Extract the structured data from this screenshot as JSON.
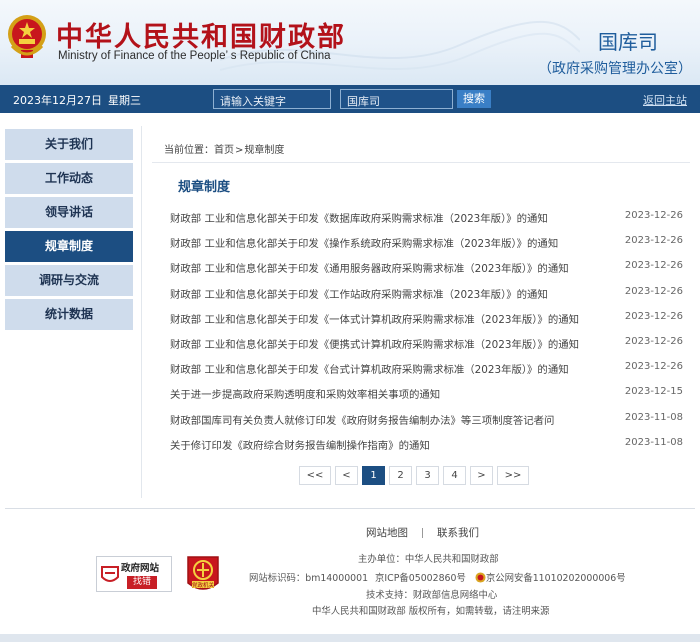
{
  "header": {
    "site_title_cn": "中华人民共和国财政部",
    "site_title_en": "Ministry of Finance of the People’ s Republic of China",
    "department": "国库司",
    "department_sub": "（政府采购管理办公室）"
  },
  "topbar": {
    "date": "2023年12月27日",
    "weekday": "星期三",
    "search_placeholder": "请输入关键字",
    "dept_select_value": "国库司",
    "search_button": "搜索",
    "home_link": "返回主站"
  },
  "sidebar": {
    "items": [
      {
        "label": "关于我们",
        "active": false
      },
      {
        "label": "工作动态",
        "active": false
      },
      {
        "label": "领导讲话",
        "active": false
      },
      {
        "label": "规章制度",
        "active": true
      },
      {
        "label": "调研与交流",
        "active": false
      },
      {
        "label": "统计数据",
        "active": false
      }
    ]
  },
  "breadcrumb": {
    "prefix": "当前位置：",
    "home": "首页",
    "separator": ">",
    "current": "规章制度"
  },
  "section_title": "规章制度",
  "news": [
    {
      "title": "财政部 工业和信息化部关于印发《数据库政府采购需求标准（2023年版）》的通知",
      "date": "2023-12-26"
    },
    {
      "title": "财政部 工业和信息化部关于印发《操作系统政府采购需求标准（2023年版）》的通知",
      "date": "2023-12-26"
    },
    {
      "title": "财政部 工业和信息化部关于印发《通用服务器政府采购需求标准（2023年版）》的通知",
      "date": "2023-12-26"
    },
    {
      "title": "财政部 工业和信息化部关于印发《工作站政府采购需求标准（2023年版）》的通知",
      "date": "2023-12-26"
    },
    {
      "title": "财政部 工业和信息化部关于印发《一体式计算机政府采购需求标准（2023年版）》的通知",
      "date": "2023-12-26"
    },
    {
      "title": "财政部 工业和信息化部关于印发《便携式计算机政府采购需求标准（2023年版）》的通知",
      "date": "2023-12-26"
    },
    {
      "title": "财政部 工业和信息化部关于印发《台式计算机政府采购需求标准（2023年版）》的通知",
      "date": "2023-12-26"
    },
    {
      "title": "关于进一步提高政府采购透明度和采购效率相关事项的通知",
      "date": "2023-12-15"
    },
    {
      "title": "财政部国库司有关负责人就修订印发《政府财务报告编制办法》等三项制度答记者问",
      "date": "2023-11-08"
    },
    {
      "title": "关于修订印发《政府综合财务报告编制操作指南》的通知",
      "date": "2023-11-08"
    }
  ],
  "pagination": {
    "first": "<<",
    "prev": "<",
    "pages": [
      "1",
      "2",
      "3",
      "4"
    ],
    "current": "1",
    "next": ">",
    "last": ">>"
  },
  "footer": {
    "links": [
      "网站地图",
      "联系我们"
    ],
    "sponsor": "主办单位：中华人民共和国财政部",
    "site_id": "网站标识码：bm14000001",
    "icp": "京ICP备05002860号",
    "police_record": "京公网安备11010202000006号",
    "tech_support": "技术支持：财政部信息网络中心",
    "copyright": "中华人民共和国财政部  版权所有，如需转载，请注明来源",
    "gov_badge_title": "政府网站",
    "gov_badge_action": "找错",
    "party_badge_text": "党政机关"
  },
  "colors": {
    "brand_red": "#b3121a",
    "nav_blue": "#1c4e82",
    "sidebar_inactive": "#cfdcec",
    "link_blue": "#1f5d9c"
  },
  "icons": [
    "national-emblem-icon",
    "police-badge-icon",
    "gov-site-error-badge-icon",
    "party-gov-badge-icon"
  ]
}
